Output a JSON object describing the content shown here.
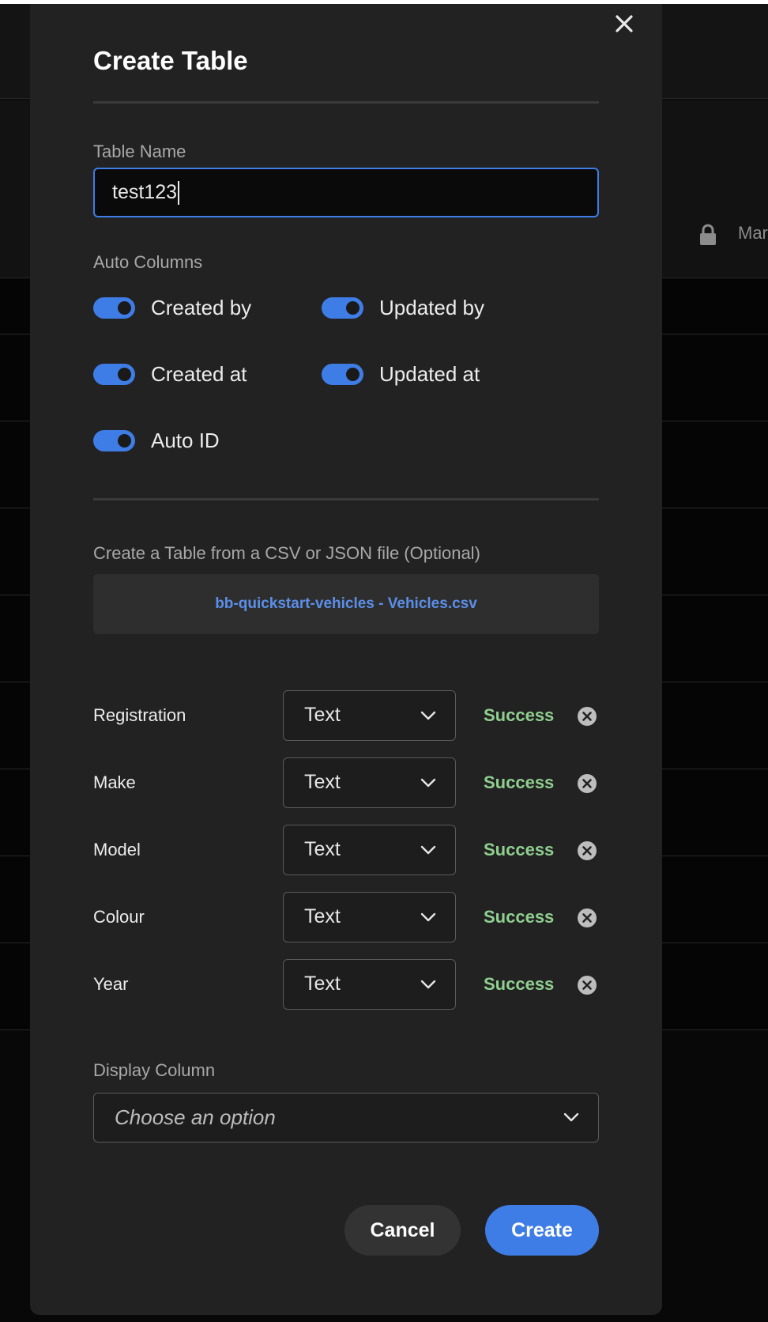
{
  "background": {
    "header_right_text": "Mar"
  },
  "modal": {
    "title": "Create Table",
    "table_name": {
      "label": "Table Name",
      "value": "test123"
    },
    "auto_columns": {
      "label": "Auto Columns",
      "toggles": [
        {
          "label": "Created by",
          "on": true
        },
        {
          "label": "Updated by",
          "on": true
        },
        {
          "label": "Created at",
          "on": true
        },
        {
          "label": "Updated at",
          "on": true
        },
        {
          "label": "Auto ID",
          "on": true
        }
      ]
    },
    "file_import": {
      "label": "Create a Table from a CSV or JSON file (Optional)",
      "file_name": "bb-quickstart-vehicles - Vehicles.csv"
    },
    "columns": [
      {
        "name": "Registration",
        "type": "Text",
        "status": "Success"
      },
      {
        "name": "Make",
        "type": "Text",
        "status": "Success"
      },
      {
        "name": "Model",
        "type": "Text",
        "status": "Success"
      },
      {
        "name": "Colour",
        "type": "Text",
        "status": "Success"
      },
      {
        "name": "Year",
        "type": "Text",
        "status": "Success"
      }
    ],
    "display_column": {
      "label": "Display Column",
      "placeholder": "Choose an option"
    },
    "buttons": {
      "cancel": "Cancel",
      "create": "Create"
    }
  },
  "colors": {
    "accent": "#3f7de6",
    "success": "#8fcf8f",
    "modal_bg": "#222222"
  }
}
